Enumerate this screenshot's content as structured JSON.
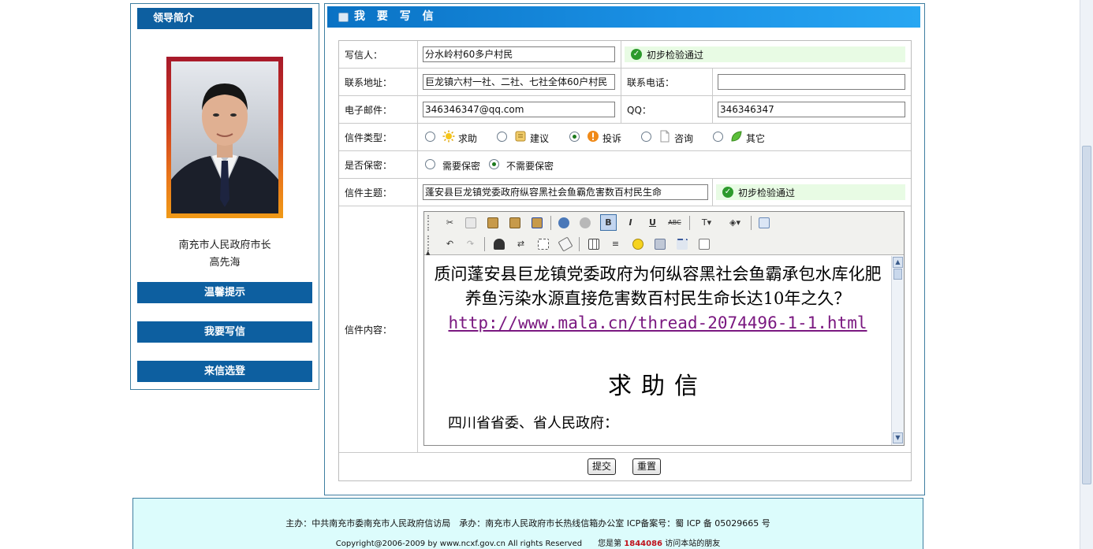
{
  "sidebar": {
    "header": "领导简介",
    "leader_title": "南充市人民政府市长",
    "leader_name": "高先海",
    "buttons": [
      "温馨提示",
      "我要写信",
      "来信选登"
    ]
  },
  "main": {
    "header": "我 要 写 信",
    "fields": {
      "writer_label": "写信人：",
      "writer_value": "分水岭村60多户村民",
      "writer_check": "初步检验通过",
      "address_label": "联系地址：",
      "address_value": "巨龙镇六村一社、二社、七社全体60户村民",
      "phone_label": "联系电话：",
      "phone_value": "",
      "email_label": "电子邮件：",
      "email_value": "346346347@qq.com",
      "qq_label": "QQ：",
      "qq_value": "346346347",
      "type_label": "信件类型：",
      "type_options": [
        "求助",
        "建议",
        "投诉",
        "咨询",
        "其它"
      ],
      "type_selected": "投诉",
      "secret_label": "是否保密：",
      "secret_options": [
        "需要保密",
        "不需要保密"
      ],
      "secret_selected": "不需要保密",
      "subject_label": "信件主题：",
      "subject_value": "蓬安县巨龙镇党委政府纵容黑社会鱼霸危害数百村民生命",
      "subject_check": "初步检验通过",
      "content_label": "信件内容："
    },
    "editor": {
      "toolbar_row1": [
        "cut",
        "copy",
        "paste",
        "paste-text",
        "paste-word",
        "link",
        "unlink",
        "bold",
        "italic",
        "underline",
        "strikethrough",
        "text-color",
        "bg-color",
        "source"
      ],
      "toolbar_row2": [
        "undo",
        "redo",
        "find",
        "replace",
        "select-all",
        "remove-format",
        "table",
        "rule",
        "smiley",
        "special-char",
        "page-break",
        "preview"
      ],
      "bold_label": "B",
      "italic_label": "I",
      "underline_label": "U",
      "strike_label": "ABC",
      "content_text": "质问蓬安县巨龙镇党委政府为何纵容黑社会鱼霸承包水库化肥养鱼污染水源直接危害数百村民生命长达10年之久？",
      "content_link": "http://www.mala.cn/thread-2074496-1-1.html",
      "content_title": "求助信",
      "content_greeting": "四川省省委、省人民政府："
    },
    "buttons": {
      "submit": "提交",
      "reset": "重置"
    }
  },
  "footer": {
    "line1": "主办：中共南充市委南充市人民政府信访局　承办：南充市人民政府市长热线信箱办公室 ICP备案号：蜀 ICP 备 05029665 号",
    "line2_prefix": "Copyright@2006-2009 by www.ncxf.gov.cn All rights Reserved　　您是第",
    "visitor_count": "1844086",
    "line2_suffix": "访问本站的朋友"
  },
  "colors": {
    "header_blue": "#0d5fa0",
    "panel_gradient": "#1b92e6",
    "footer_bg": "#dcfcfc",
    "check_green": "#2c9a2c",
    "link_purple": "#7a1880",
    "count_red": "#c0101a"
  }
}
